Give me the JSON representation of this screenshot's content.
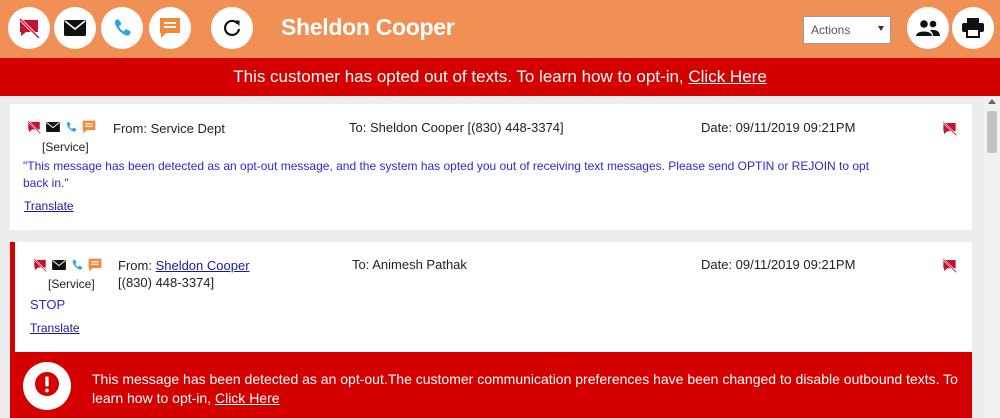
{
  "header": {
    "title": "Sheldon Cooper",
    "actions_label": "Actions",
    "buttons": {
      "optout": "opted-out-message-icon",
      "email": "envelope-icon",
      "phone": "phone-icon",
      "sms": "chat-bubble-icon",
      "refresh": "refresh-icon",
      "contacts": "people-icon",
      "print": "printer-icon"
    }
  },
  "banner": {
    "text": "This customer has opted out of texts. To learn how to opt-in, ",
    "link": "Click Here"
  },
  "messages": [
    {
      "from_prefix": "From: ",
      "from": "Service Dept",
      "tag": "[Service]",
      "to": "To: Sheldon Cooper [(830) 448-3374]",
      "date": "Date: 09/11/2019 09:21PM",
      "body": "\"This message has been detected as an opt-out message, and the system has opted you out of receiving text messages. Please send OPTIN or REJOIN to opt back in.\"",
      "translate": "Translate"
    },
    {
      "from_prefix": "From: ",
      "from_link": "Sheldon Cooper",
      "from_phone": "[(830) 448-3374]",
      "tag": "[Service]",
      "to": "To: Animesh Pathak",
      "date": "Date: 09/11/2019 09:21PM",
      "body": "STOP",
      "translate": "Translate"
    }
  ],
  "alert": {
    "text": "This message has been detected as an opt-out.The customer communication preferences have been changed to disable outbound texts. To learn how to opt-in, ",
    "link": "Click Here"
  },
  "colors": {
    "header_bg": "#f09055",
    "alert_red": "#d40000",
    "icon_red": "#c41230",
    "phone_blue": "#2aa7e0",
    "sms_orange": "#f08a3c"
  }
}
